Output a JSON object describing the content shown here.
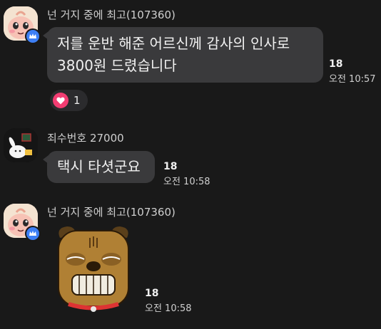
{
  "messages": [
    {
      "sender": "넌 거지 중에 최고(107360)",
      "lines": [
        "저를 운반 해준 어르신께 감사의 인사로",
        "3800원 드렸습니다"
      ],
      "unread": "18",
      "time": "오전 10:57",
      "reaction": {
        "icon": "heart-icon",
        "count": "1"
      }
    },
    {
      "sender": "죄수번호 27000",
      "lines": [
        "택시 타셧군요"
      ],
      "unread": "18",
      "time": "오전 10:58"
    },
    {
      "sender": "넌 거지 중에 최고(107360)",
      "sticker": "frog-dog-character-sticker",
      "unread": "18",
      "time": "오전 10:58"
    }
  ],
  "colors": {
    "background": "#191919",
    "bubble": "#3a3a3c",
    "heart": "#f23d72",
    "crown_badge": "#3d7ff5"
  }
}
